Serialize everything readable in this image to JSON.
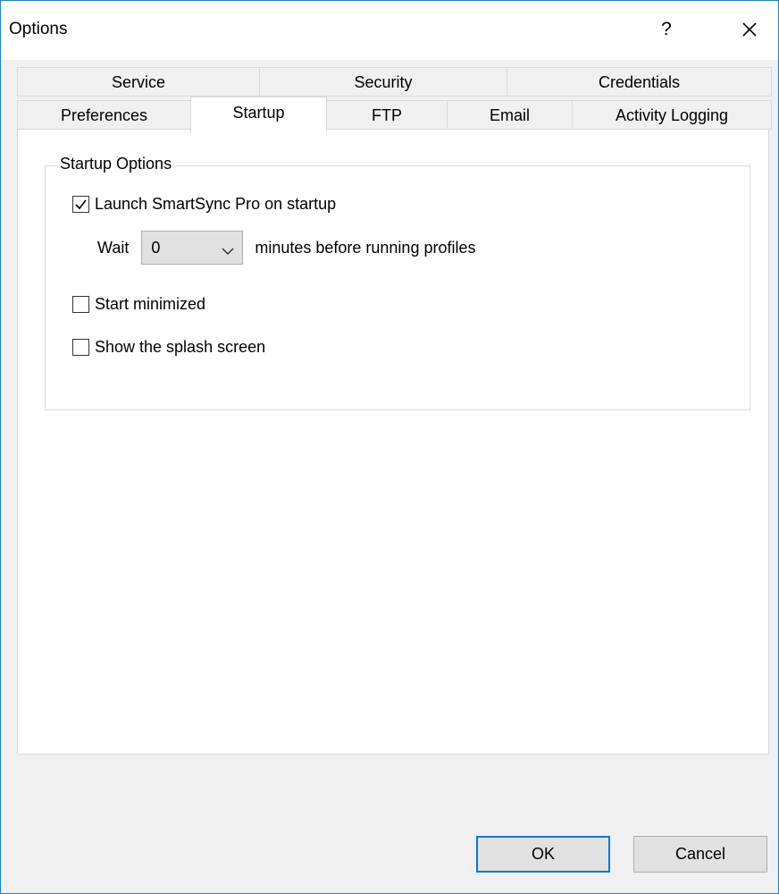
{
  "window": {
    "title": "Options",
    "help_label": "?"
  },
  "tabs": {
    "row_top": [
      "Service",
      "Security",
      "Credentials"
    ],
    "row_bottom": [
      "Preferences",
      "Startup",
      "FTP",
      "Email",
      "Activity Logging"
    ],
    "active": "Startup"
  },
  "startup": {
    "group_label": "Startup Options",
    "launch_label": "Launch SmartSync Pro on startup",
    "launch_checked": true,
    "wait_prefix": "Wait",
    "wait_value": "0",
    "wait_suffix": "minutes before running profiles",
    "minimized_label": "Start minimized",
    "minimized_checked": false,
    "splash_label": "Show the splash screen",
    "splash_checked": false
  },
  "buttons": {
    "ok": "OK",
    "cancel": "Cancel"
  },
  "colors": {
    "accent": "#0078d7",
    "window_border": "#1883d7",
    "dialog_bg": "#f0f0f0"
  }
}
